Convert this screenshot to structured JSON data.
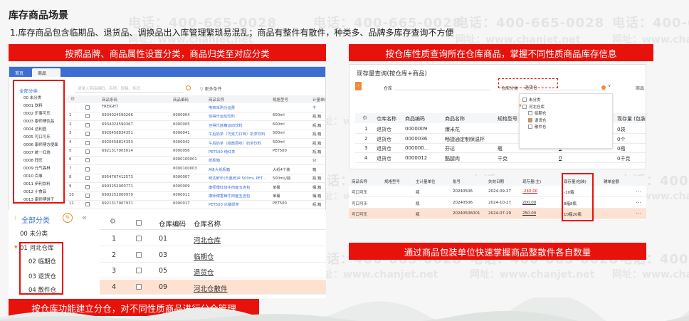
{
  "header": {
    "title": "库存商品场景",
    "description": "1.库存商品包含临期品、退货品、调换品出入库管理繁琐易混乱；商品有整件有散件，种类多、品牌多库存查询不方便"
  },
  "watermarks": {
    "phone": "电话：400-665-0028",
    "site": "网址：www.chanjet.net"
  },
  "callouts": {
    "top_left": "按照品牌、商品属性设置分类，商品归类至对应分类",
    "top_right": "按仓库性质查询所在仓库商品，掌握不同性质商品库存信息",
    "bottom_left": "按仓库功能建立分仓，对不同性质商品进行分仓管理",
    "bottom_right": "通过商品包装单位快速掌握商品整散件各自数量"
  },
  "product_screen": {
    "tabs": [
      "首页",
      "商品"
    ],
    "tree_title": "全部分类",
    "tree_items": [
      "00 未分类",
      "0001 饮料",
      "0002 乐事可乐",
      "0003 康师傅饮品",
      "0004 达利园",
      "0005 可口可乐",
      "0006 康师傅方便面",
      "0007 统一红烧",
      "0008 旺旺",
      "0009 元气森林",
      "0010 百事",
      "0011 伊利饮料",
      "0012 小食品",
      "0013 康师傅饼干"
    ],
    "search_placeholder": "请录入商品编码、名称、规格、条码",
    "filter_label": "更多条件",
    "columns": [
      "",
      "",
      "商品条码",
      "商品编码",
      "商品名称",
      "规格型号",
      "计量单位"
    ],
    "rows": [
      [
        "",
        "",
        "FREIGHT",
        "",
        "电商采购分运费",
        "",
        "个"
      ],
      [
        "1",
        "",
        "6934024590266",
        "0000004",
        "佳得乐运动饮料",
        "600ml",
        "瓶,箱"
      ],
      [
        "2",
        "",
        "6934024590367",
        "0000005",
        "佳得乐蓝莓运动饮料",
        "600ml",
        "瓶,箱"
      ],
      [
        "3",
        "",
        "6920458834351",
        "0000041",
        "午后奶茶（巧克力口味）奶茶饮料",
        "500ml",
        "瓶,箱"
      ],
      [
        "4",
        "",
        "6920458814353",
        "0000042",
        "午后奶茶（经典原味）奶茶饮料",
        "500ml",
        "瓶,箱"
      ],
      [
        "5",
        "",
        "6921317905014",
        "0000056",
        "PET500 纯红茶",
        "PET500",
        "瓶,箱"
      ],
      [
        "6",
        "",
        "",
        "0000100001",
        "纸板箱",
        "",
        "只"
      ],
      [
        "7",
        "",
        "",
        "0000100003",
        "A级大纸板箱",
        "大纸4个装",
        "箱"
      ],
      [
        "8",
        "",
        "6954767412573",
        "0000007",
        "统达鲜乐(乐嘉统)R 500mL PET...",
        "500mL/瓶",
        "瓶,箱"
      ],
      [
        "9",
        "",
        "6903252000771",
        "0000009",
        "康师傅红烧牛肉面五连包",
        "单桶",
        "桶,箱"
      ],
      [
        "10",
        "",
        "6903252000979",
        "0000011",
        "康师傅香辣牛肉面五连包",
        "单桶",
        "桶,箱"
      ],
      [
        "11",
        "",
        "6921317907931",
        "0000017",
        "PET500 冰橘绿茶",
        "PET500",
        "瓶,箱"
      ]
    ]
  },
  "warehouse_tree": {
    "title": "全部分类",
    "items": [
      "00 未分类",
      "01 河北仓库",
      "02 临期仓",
      "03 退货仓",
      "04 散件仓"
    ]
  },
  "warehouse_table": {
    "columns": [
      "",
      "",
      "仓库编码",
      "仓库名称"
    ],
    "rows": [
      {
        "n": "1",
        "code": "01",
        "name": "河北仓库"
      },
      {
        "n": "2",
        "code": "03",
        "name": "临期仓"
      },
      {
        "n": "3",
        "code": "05",
        "name": "退货仓"
      },
      {
        "n": "4",
        "code": "09",
        "name": "河北仓散件"
      }
    ]
  },
  "stock_query": {
    "title": "现存量查询(按仓库+商品)",
    "warehouse_label": "仓库",
    "class_label": "仓库分类",
    "class_value": "退货仓",
    "product_label": "商品",
    "dropdown_items": [
      "未分类",
      "河北仓库",
      "临期仓",
      "退货仓",
      "散件仓"
    ],
    "columns": [
      "",
      "仓库名称",
      "商品编码",
      "商品名称",
      "规格型号",
      "",
      "现存量 (包装)"
    ],
    "rows": [
      [
        "1",
        "退货仓",
        "0000009",
        "爆米花",
        "",
        "",
        "0袋"
      ],
      [
        "2",
        "退货仓",
        "0000036",
        "畅捷通定制保温杯",
        "",
        "",
        "0个"
      ],
      [
        "3",
        "退货仓",
        "000000...",
        "芬达",
        "瓶",
        "0",
        "0瓶"
      ],
      [
        "4",
        "退货仓",
        "0000012",
        "酷腿肉",
        "千克",
        "0",
        "0千克"
      ]
    ]
  },
  "batch_table": {
    "columns": [
      "商品名称",
      "规格型号",
      "主计量单位",
      "批号",
      "失效日期",
      "现存量(主)",
      "现存量(包装)",
      "辅单金额"
    ],
    "rows": [
      {
        "name": "可口可乐",
        "unit": "瓶",
        "batch": "20240506",
        "date": "2024-09-27",
        "qty": "-240.00",
        "pack": "-10箱",
        "neg": true
      },
      {
        "name": "可口可乐",
        "unit": "瓶",
        "batch": "20240506",
        "date": "2024-10-27",
        "qty": "200.00",
        "pack": "8箱8瓶",
        "neg": false
      },
      {
        "name": "可口可乐",
        "unit": "瓶",
        "batch": "20240506001",
        "date": "2024-07-29",
        "qty": "250.00",
        "pack": "10箱20瓶",
        "neg": false
      }
    ]
  },
  "colors": {
    "accent_red": "#e8120c",
    "highlight": "#fde2d2",
    "link_blue": "#3b6fd1"
  }
}
